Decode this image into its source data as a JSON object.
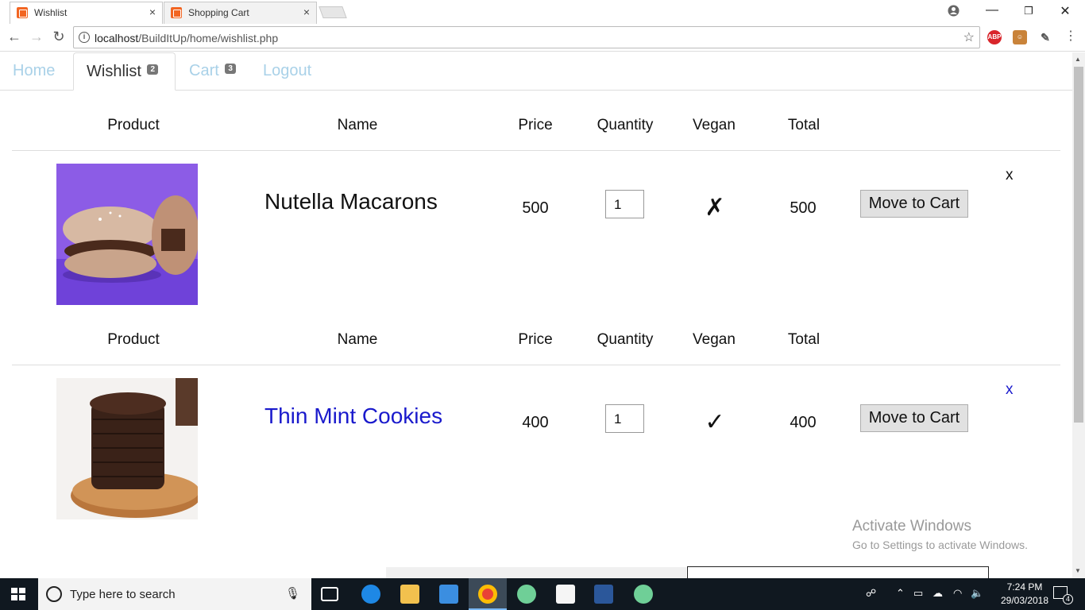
{
  "browser": {
    "tabs": [
      {
        "title": "Wishlist",
        "close": "×"
      },
      {
        "title": "Shopping Cart",
        "close": "×"
      }
    ],
    "url_host": "localhost",
    "url_path": "/BuildItUp/home/wishlist.php",
    "window_controls": {
      "minimize": "—",
      "maximize": "❐",
      "close": "✕"
    }
  },
  "nav": {
    "home": "Home",
    "wishlist": "Wishlist",
    "wishlist_count": "2",
    "cart": "Cart",
    "cart_count": "3",
    "logout": "Logout"
  },
  "table": {
    "headers": {
      "product": "Product",
      "name": "Name",
      "price": "Price",
      "quantity": "Quantity",
      "vegan": "Vegan",
      "total": "Total"
    },
    "items": [
      {
        "name": "Nutella Macarons",
        "price": "500",
        "quantity": "1",
        "vegan": "✗",
        "total": "500",
        "action": "Move to Cart",
        "remove": "x",
        "image": "macaron-image"
      },
      {
        "name": "Thin Mint Cookies",
        "price": "400",
        "quantity": "1",
        "vegan": "✓",
        "total": "400",
        "action": "Move to Cart",
        "remove": "x",
        "image": "cookies-image"
      }
    ]
  },
  "watermark": {
    "line1": "Activate Windows",
    "line2": "Go to Settings to activate Windows."
  },
  "taskbar": {
    "search_placeholder": "Type here to search",
    "time": "7:24 PM",
    "date": "29/03/2018",
    "notifications": "4"
  },
  "colors": {
    "nav_inactive": "#a9d1e8",
    "link_blue": "#1a1acc",
    "taskbar": "#101820"
  }
}
